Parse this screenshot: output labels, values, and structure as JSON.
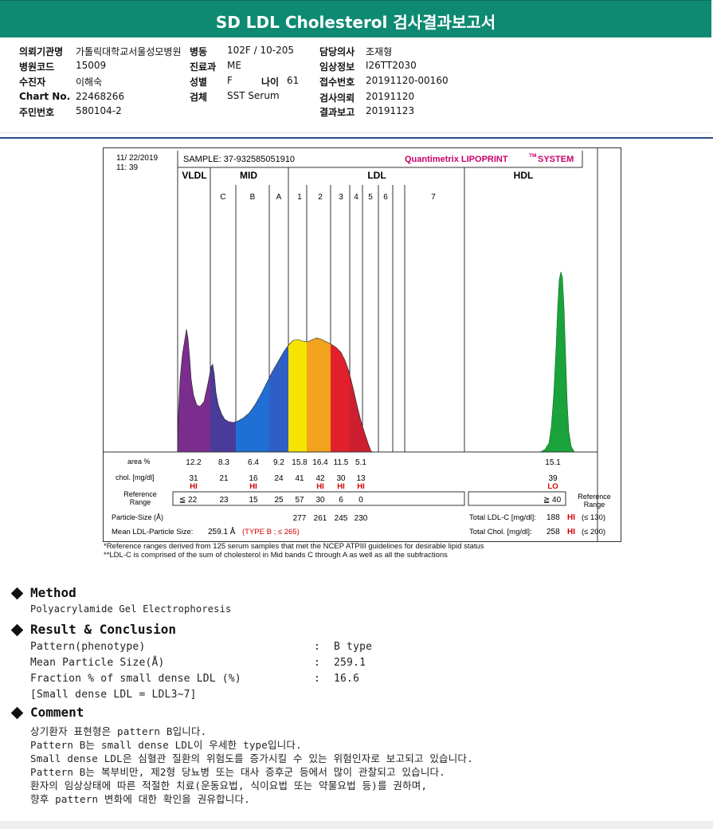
{
  "title": "SD LDL Cholesterol 검사결과보고서",
  "info": {
    "col1": [
      {
        "label": "의뢰기관명",
        "value": "가톨릭대학교서울성모병원"
      },
      {
        "label": "병원코드",
        "value": "15009"
      },
      {
        "label": "수진자",
        "value": "이해숙"
      },
      {
        "label": "Chart No.",
        "value": "22468266"
      },
      {
        "label": "주민번호",
        "value": "580104-2"
      }
    ],
    "col2": [
      {
        "label": "병동",
        "value": "102F / 10-205"
      },
      {
        "label": "진료과",
        "value": "ME"
      },
      {
        "label": "성별",
        "value": "F"
      },
      {
        "label": "검체",
        "value": "SST Serum"
      }
    ],
    "age": {
      "label": "나이",
      "value": "61"
    },
    "col3": [
      {
        "label": "담당의사",
        "value": "조재형"
      },
      {
        "label": "임상정보",
        "value": "I26TT2030"
      },
      {
        "label": "접수번호",
        "value": "20191120-00160"
      },
      {
        "label": "검사의뢰",
        "value": "20191120"
      },
      {
        "label": "결과보고",
        "value": "20191123"
      }
    ]
  },
  "chart": {
    "date": "11/ 22/2019",
    "time": "11: 39",
    "sample": "SAMPLE:  37-932585051910",
    "brand_a": "Quantimetrix LIPOPRINT",
    "brand_tm": "TM",
    "brand_b": "SYSTEM",
    "groups": [
      "VLDL",
      "MID",
      "LDL",
      "HDL"
    ],
    "bands": [
      "C",
      "B",
      "A",
      "1",
      "2",
      "3",
      "4",
      "5",
      "6",
      "7"
    ],
    "row_labels": {
      "area": "area %",
      "chol": "chol. [mg/dl]",
      "ref": "Reference\nRange",
      "ref_right": "Reference\nRange",
      "psize": "Particle-Size (Å)"
    },
    "area": [
      "12.2",
      "8.3",
      "6.4",
      "9.2",
      "15.8",
      "16.4",
      "11.5",
      "5.1",
      "15.1"
    ],
    "chol": [
      "31",
      "21",
      "16",
      "24",
      "41",
      "42",
      "30",
      "13",
      "39"
    ],
    "flags": [
      "HI",
      "",
      "HI",
      "",
      "",
      "HI",
      "HI",
      "HI",
      "LO"
    ],
    "ref": [
      "≦ 22",
      "23",
      "15",
      "25",
      "57",
      "30",
      "6",
      "0"
    ],
    "hdl_ref": "≧ 40",
    "psize": [
      "277",
      "261",
      "245",
      "230"
    ],
    "mean_size_label": "Mean LDL-Particle Size:",
    "mean_size_value": "259.1 Å",
    "mean_size_type": "(TYPE B ; ≤ 265)",
    "total_ldl_label": "Total LDL-C [mg/dl]:",
    "total_ldl_value": "188",
    "total_ldl_flag": "HI",
    "total_ldl_ref": "(≤ 130)",
    "total_chol_label": "Total Chol. [mg/dl]:",
    "total_chol_value": "258",
    "total_chol_flag": "HI",
    "total_chol_ref": "(≤ 200)",
    "colors": {
      "vldl": "#7b2d8e",
      "c": "#4a3a9a",
      "b": "#1f6fd4",
      "a": "#2f5fc4",
      "l1": "#f4e400",
      "l2": "#f2a21c",
      "l3": "#e0202a",
      "l4": "#cc1f30",
      "hdl": "#1aa33a",
      "flag": "#d10000",
      "brand": "#c8006a"
    }
  },
  "footnotes": [
    "*Reference ranges derived from 125 serum samples that met the NCEP ATPIII guidelines for desirable lipid status",
    "**LDL-C is comprised of the sum of cholesterol in Mid bands C through A as well as all the subfractions"
  ],
  "method": {
    "heading": "Method",
    "text": "Polyacrylamide Gel Electrophoresis"
  },
  "result": {
    "heading": "Result & Conclusion",
    "rows": [
      {
        "label": "Pattern(phenotype)",
        "value": "B type"
      },
      {
        "label": "Mean Particle Size(Å)",
        "value": "259.1"
      },
      {
        "label": "Fraction % of small dense LDL (%)",
        "value": "16.6"
      }
    ],
    "sep": ":",
    "note": "[Small dense LDL = LDL3~7]"
  },
  "comment": {
    "heading": "Comment",
    "lines": [
      "상기환자 표현형은 pattern B입니다.",
      "Pattern B는 small dense LDL이 우세한 type입니다.",
      "Small dense LDL은 심혈관 질환의 위험도를 증가시킬 수 있는 위험인자로 보고되고 있습니다.",
      "Pattern B는 복부비만, 제2형 당뇨병 또는 대사 증후군 등에서 많이 관찰되고 있습니다.",
      "환자의 임상상태에 따른 적절한 치료(운동요법, 식이요법 또는 약물요법 등)를 권하며,",
      "향후 pattern 변화에 대한 확인을 권유합니다."
    ]
  }
}
